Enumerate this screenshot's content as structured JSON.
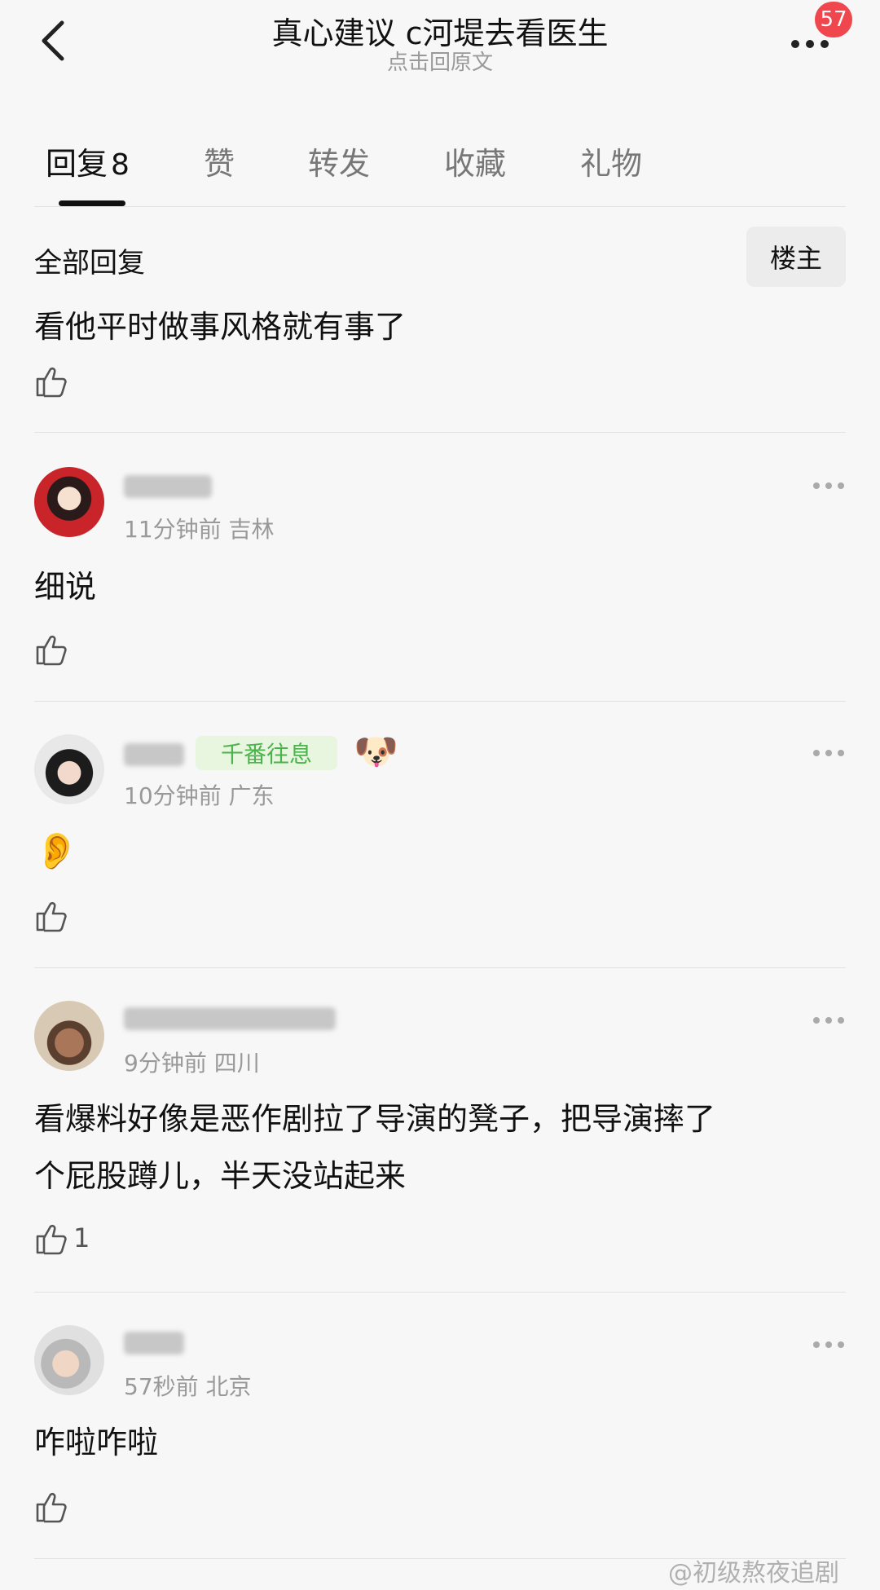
{
  "header": {
    "title": "真心建议 c河堤去看医生",
    "subtitle": "点击回原文",
    "badge": "57"
  },
  "tabs": [
    {
      "label": "回复",
      "count": "8"
    },
    {
      "label": "赞"
    },
    {
      "label": "转发"
    },
    {
      "label": "收藏"
    },
    {
      "label": "礼物"
    }
  ],
  "section": {
    "title": "全部回复",
    "op_button": "楼主"
  },
  "first_comment": {
    "text": "看他平时做事风格就有事了"
  },
  "comments": [
    {
      "time": "11分钟前",
      "location": "吉林",
      "text": "细说"
    },
    {
      "time": "10分钟前",
      "location": "广东",
      "vip": "千番往息",
      "text": "👂"
    },
    {
      "time": "9分钟前",
      "location": "四川",
      "text_line1": "看爆料好像是恶作剧拉了导演的凳子，把导演摔了",
      "text_line2": "个屁股蹲儿，半天没站起来",
      "likes": "1"
    },
    {
      "time": "57秒前",
      "location": "北京",
      "text": "咋啦咋啦"
    }
  ],
  "watermark": "@初级熬夜追剧"
}
